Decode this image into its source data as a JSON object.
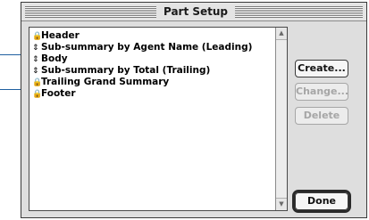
{
  "dialog": {
    "title": "Part Setup"
  },
  "parts": [
    {
      "icon": "lock-icon",
      "label": "Header"
    },
    {
      "icon": "updown-icon",
      "label": "Sub-summary by Agent Name (Leading)"
    },
    {
      "icon": "updown-icon",
      "label": "Body"
    },
    {
      "icon": "updown-icon",
      "label": "Sub-summary by Total (Trailing)"
    },
    {
      "icon": "lock-icon",
      "label": "Trailing Grand Summary"
    },
    {
      "icon": "lock-icon",
      "label": "Footer"
    }
  ],
  "buttons": {
    "create": "Create...",
    "change": "Change...",
    "delete": "Delete",
    "done": "Done"
  },
  "glyphs": {
    "lock": "🔒",
    "updown": "⇕"
  }
}
